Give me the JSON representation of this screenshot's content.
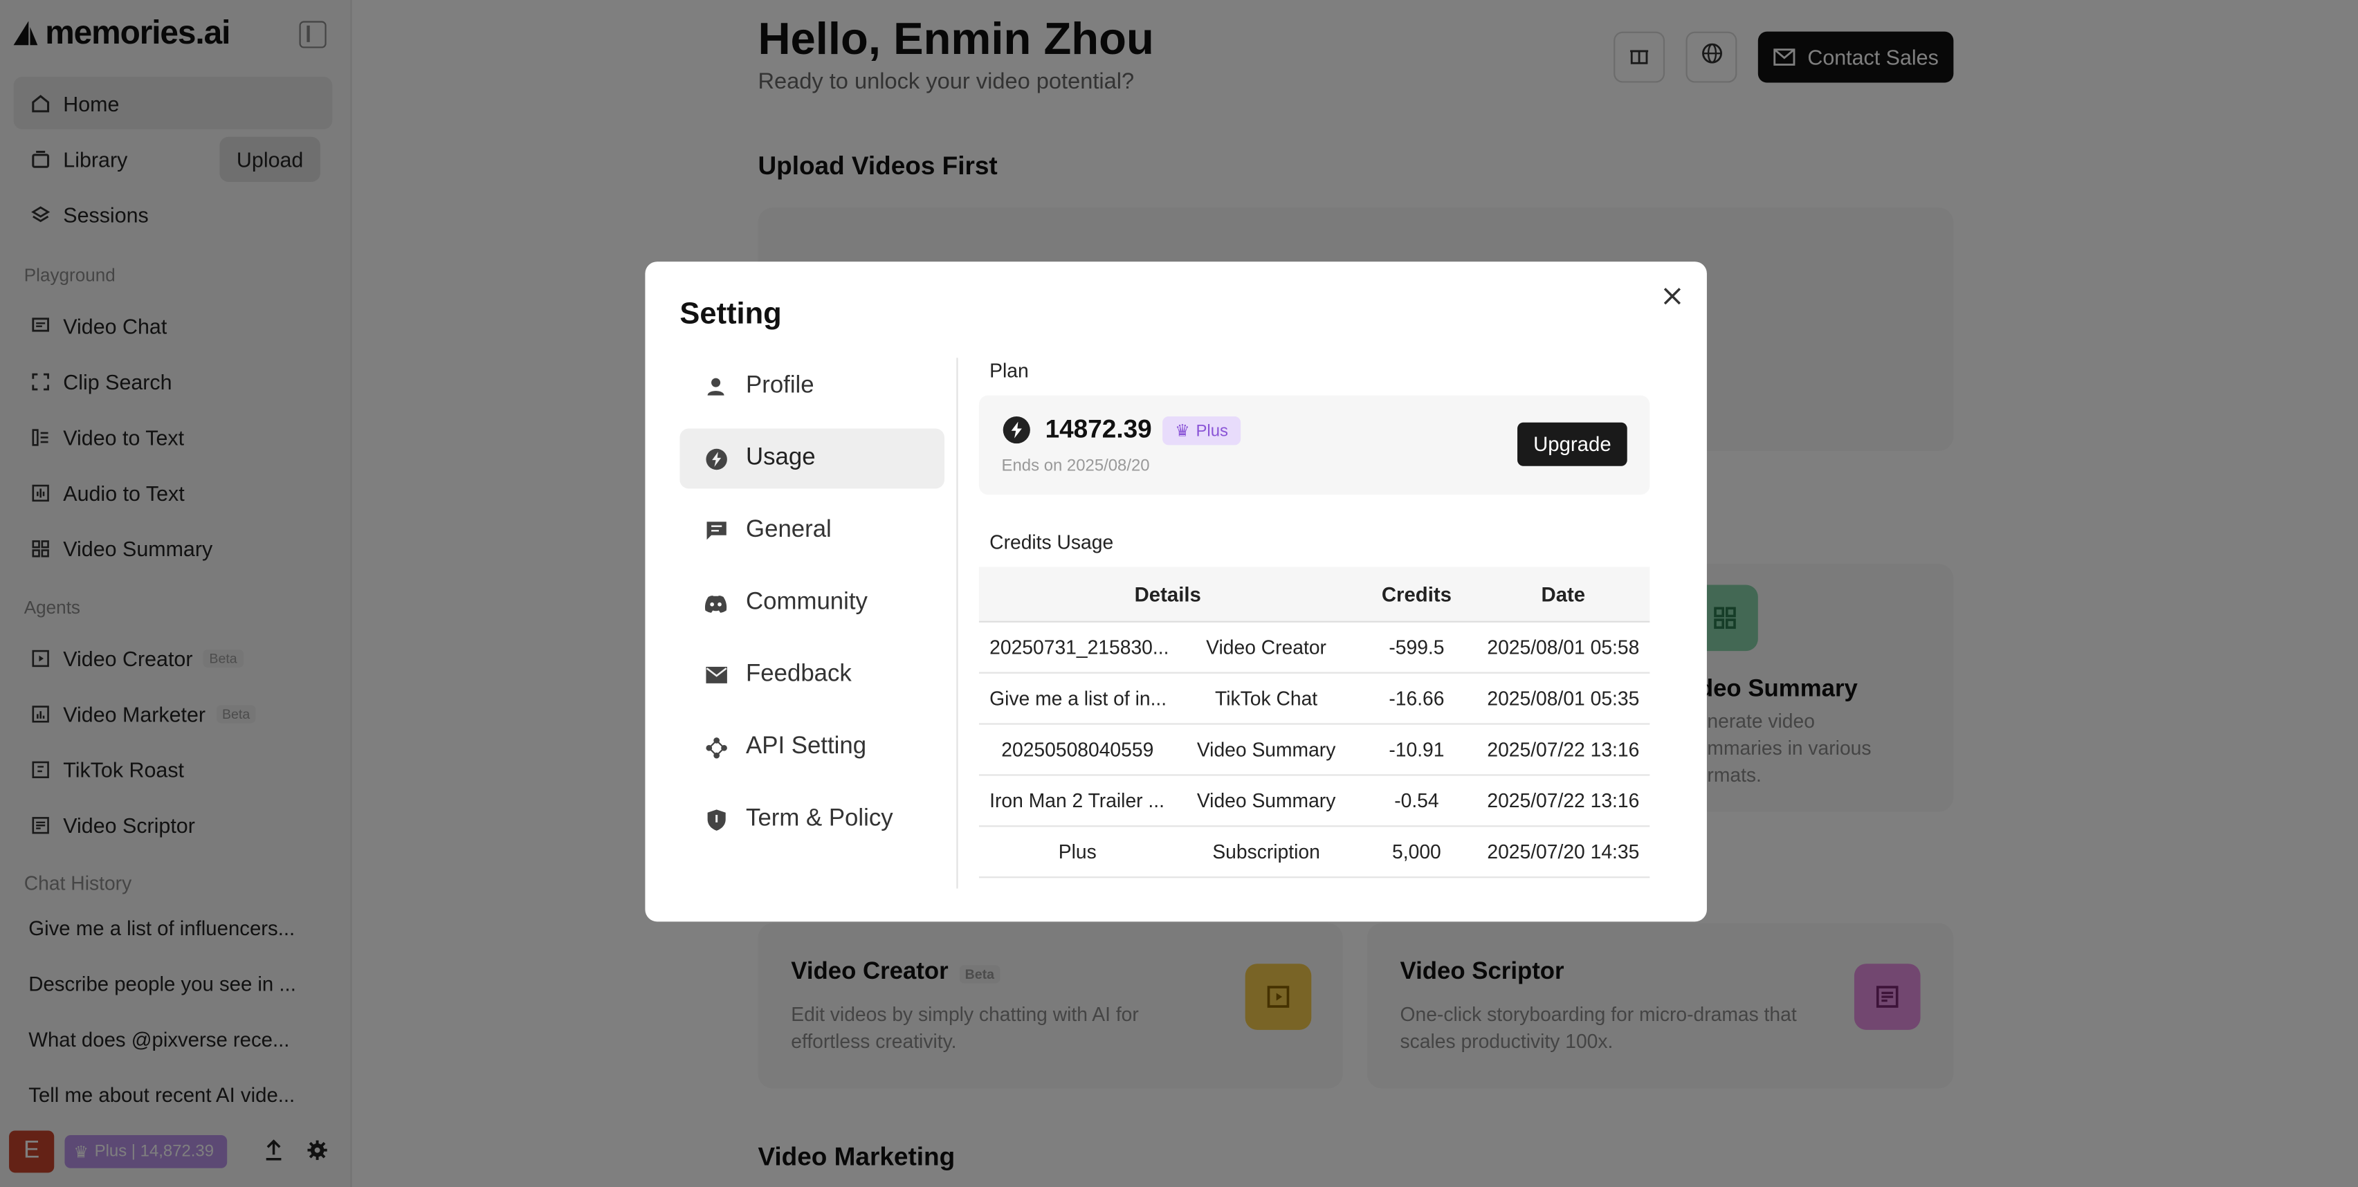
{
  "app": {
    "logo_text": "memories.ai"
  },
  "sidebar": {
    "nav": [
      {
        "label": "Home"
      },
      {
        "label": "Library"
      },
      {
        "label": "Sessions"
      }
    ],
    "upload_label": "Upload",
    "playground_label": "Playground",
    "playground": [
      {
        "label": "Video Chat"
      },
      {
        "label": "Clip Search"
      },
      {
        "label": "Video to Text"
      },
      {
        "label": "Audio to Text"
      },
      {
        "label": "Video Summary"
      }
    ],
    "agents_label": "Agents",
    "agents": [
      {
        "label": "Video Creator",
        "badge": "Beta"
      },
      {
        "label": "Video Marketer",
        "badge": "Beta"
      },
      {
        "label": "TikTok Roast"
      },
      {
        "label": "Video Scriptor"
      }
    ],
    "history_label": "Chat History",
    "history": [
      "Give me a list of influencers...",
      "Describe people you see in ...",
      "What does @pixverse rece...",
      "Tell me about recent AI vide..."
    ],
    "avatar_letter": "E",
    "plan_pill": "Plus | 14,872.39"
  },
  "main": {
    "greeting": "Hello, Enmin Zhou",
    "subgreeting": "Ready to unlock your video potential?",
    "contact_sales": "Contact Sales",
    "upload_heading": "Upload Videos First",
    "video_marketing_heading": "Video Marketing",
    "cards": {
      "summary_title": "ideo Summary",
      "summary_desc_1": "enerate video",
      "summary_desc_2": "ummaries in various",
      "summary_desc_3": "ormats.",
      "creator_title": "Video Creator",
      "creator_badge": "Beta",
      "creator_desc_1": "Edit videos by simply chatting with AI for",
      "creator_desc_2": "effortless creativity.",
      "scriptor_title": "Video Scriptor",
      "scriptor_desc_1": "One-click storyboarding for micro-dramas that",
      "scriptor_desc_2": "scales productivity 100x."
    }
  },
  "modal": {
    "title": "Setting",
    "menu": [
      {
        "label": "Profile",
        "icon": "person-icon"
      },
      {
        "label": "Usage",
        "icon": "bolt-icon"
      },
      {
        "label": "General",
        "icon": "message-icon"
      },
      {
        "label": "Community",
        "icon": "discord-icon"
      },
      {
        "label": "Feedback",
        "icon": "mail-icon"
      },
      {
        "label": "API Setting",
        "icon": "api-icon"
      },
      {
        "label": "Term & Policy",
        "icon": "shield-icon"
      }
    ],
    "plan_label": "Plan",
    "credits": "14872.39",
    "plan_badge": "Plus",
    "ends_on": "Ends on 2025/08/20",
    "upgrade_label": "Upgrade",
    "credits_usage_label": "Credits Usage",
    "table": {
      "headers": [
        "Details",
        "Credits",
        "Date"
      ],
      "rows": [
        {
          "name": "20250731_215830...",
          "type": "Video Creator",
          "credits": "-599.5",
          "date": "2025/08/01 05:58"
        },
        {
          "name": "Give me a list of in...",
          "type": "TikTok Chat",
          "credits": "-16.66",
          "date": "2025/08/01 05:35"
        },
        {
          "name": "20250508040559",
          "type": "Video Summary",
          "credits": "-10.91",
          "date": "2025/07/22 13:16"
        },
        {
          "name": "Iron Man 2 Trailer ...",
          "type": "Video Summary",
          "credits": "-0.54",
          "date": "2025/07/22 13:16"
        },
        {
          "name": "Plus",
          "type": "Subscription",
          "credits": "5,000",
          "date": "2025/07/20 14:35"
        }
      ]
    }
  },
  "colors": {
    "accent_purple": "#8a54d6",
    "dark": "#111111",
    "avatar": "#c8452c"
  }
}
